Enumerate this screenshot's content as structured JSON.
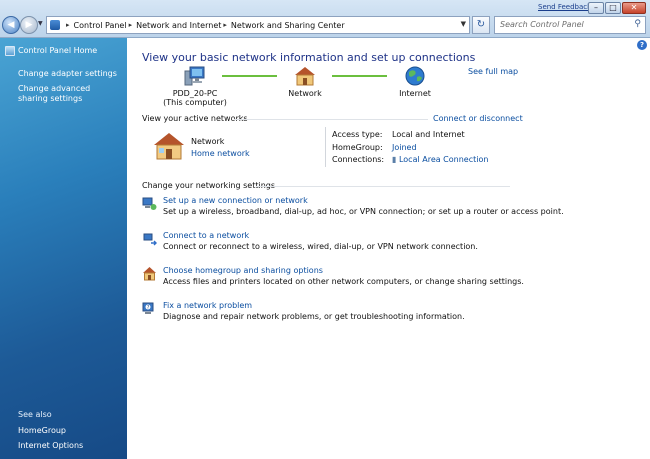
{
  "window": {
    "feedback": "Send Feedback",
    "min": "–",
    "max": "□",
    "close": "✕"
  },
  "nav": {
    "back": "◀",
    "forward": "▶",
    "dropdown": "▼"
  },
  "address": {
    "crumbs": [
      "Control Panel",
      "Network and Internet",
      "Network and Sharing Center"
    ],
    "separator": "▸"
  },
  "search": {
    "placeholder": "Search Control Panel",
    "icon": "search-icon"
  },
  "sidebar": {
    "home": "Control Panel Home",
    "links": [
      "Change adapter settings",
      "Change advanced sharing settings"
    ],
    "see_also_heading": "See also",
    "see_also": [
      "HomeGroup",
      "Internet Options"
    ]
  },
  "main": {
    "title": "View your basic network information and set up connections",
    "see_full_map": "See full map",
    "map": {
      "computer": "PDD_20-PC",
      "computer_sub": "(This computer)",
      "network": "Network",
      "internet": "Internet"
    },
    "active_heading": "View your active networks",
    "connect_link": "Connect or disconnect",
    "active_network": {
      "name": "Network",
      "type": "Home network"
    },
    "details": {
      "access_label": "Access type:",
      "access_value": "Local and Internet",
      "homegroup_label": "HomeGroup:",
      "homegroup_value": "Joined",
      "connections_label": "Connections:",
      "connections_value": "Local Area Connection"
    },
    "settings_heading": "Change your networking settings",
    "tasks": [
      {
        "title": "Set up a new connection or network",
        "desc": "Set up a wireless, broadband, dial-up, ad hoc, or VPN connection; or set up a router or access point."
      },
      {
        "title": "Connect to a network",
        "desc": "Connect or reconnect to a wireless, wired, dial-up, or VPN network connection."
      },
      {
        "title": "Choose homegroup and sharing options",
        "desc": "Access files and printers located on other network computers, or change sharing settings."
      },
      {
        "title": "Fix a network problem",
        "desc": "Diagnose and repair network problems, or get troubleshooting information."
      }
    ]
  },
  "colors": {
    "link": "#0b4ea0",
    "title": "#1e3287",
    "sidebar": "#1d5a97",
    "map_line": "#6bbf3e"
  }
}
